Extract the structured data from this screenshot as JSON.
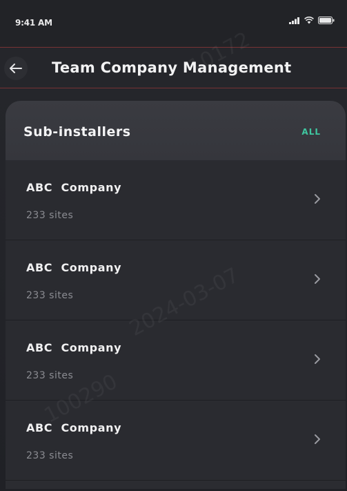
{
  "status_bar": {
    "time": "9:41 AM",
    "icons": [
      "signal-icon",
      "wifi-icon",
      "battery-icon"
    ]
  },
  "header": {
    "back_icon": "arrow-left-icon",
    "title": "Team Company Management"
  },
  "section": {
    "title": "Sub-installers",
    "all_label": "ALL"
  },
  "companies": [
    {
      "name": "ABC  Company",
      "sites": "233 sites"
    },
    {
      "name": "ABC  Company",
      "sites": "233 sites"
    },
    {
      "name": "ABC  Company",
      "sites": "233 sites"
    },
    {
      "name": "ABC  Company",
      "sites": "233 sites"
    }
  ],
  "watermark": {
    "text_a": "10172",
    "text_b": "2024-03-07",
    "text_c": "100290"
  },
  "colors": {
    "background": "#26272c",
    "card": "#2b2c31",
    "card_header": "#3a3b41",
    "accent": "#3fc7a0",
    "secondary_text": "#8b8c92"
  }
}
